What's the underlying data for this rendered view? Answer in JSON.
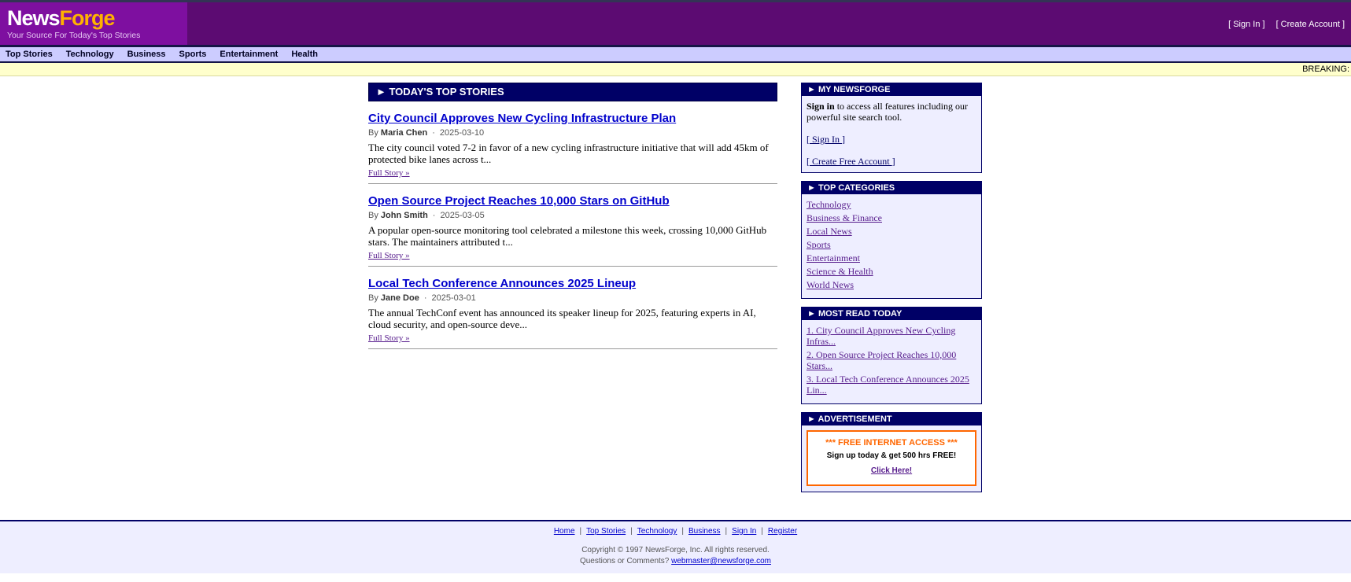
{
  "brand": {
    "name_part1": "News",
    "name_part2": "Forge",
    "tagline": "Your Source For Today's Top Stories"
  },
  "header_links": {
    "sign_in": "[ Sign In ]",
    "create_account": "[ Create Account ]"
  },
  "nav": [
    "Top Stories",
    "Technology",
    "Business",
    "Sports",
    "Entertainment",
    "Health"
  ],
  "breaking_label": "BREAKING:",
  "main": {
    "section_title": "► TODAY'S TOP STORIES",
    "stories": [
      {
        "title": "City Council Approves New Cycling Infrastructure Plan",
        "by": "By",
        "author": "Maria Chen",
        "date": "2025-03-10",
        "summary": "The city council voted 7-2 in favor of a new cycling infrastructure initiative that will add 45km of protected bike lanes across t...",
        "link": "Full Story »"
      },
      {
        "title": "Open Source Project Reaches 10,000 Stars on GitHub",
        "by": "By",
        "author": "John Smith",
        "date": "2025-03-05",
        "summary": "A popular open-source monitoring tool celebrated a milestone this week, crossing 10,000 GitHub stars. The maintainers attributed t...",
        "link": "Full Story »"
      },
      {
        "title": "Local Tech Conference Announces 2025 Lineup",
        "by": "By",
        "author": "Jane Doe",
        "date": "2025-03-01",
        "summary": "The annual TechConf event has announced its speaker lineup for 2025, featuring experts in AI, cloud security, and open-source deve...",
        "link": "Full Story »"
      }
    ]
  },
  "sidebar": {
    "my_newsforge": {
      "title": "► MY NEWSFORGE",
      "sign_in_bold": "Sign in",
      "sign_in_text": " to access all features including our powerful site search tool.",
      "bracket_open": "[",
      "bracket_close": "]",
      "sign_in_link": " Sign In ",
      "create_link": " Create Free Account "
    },
    "categories": {
      "title": "► TOP CATEGORIES",
      "items": [
        "Technology",
        "Business & Finance",
        "Local News",
        "Sports",
        "Entertainment",
        "Science & Health",
        "World News"
      ]
    },
    "most_read": {
      "title": "► MOST READ TODAY",
      "items": [
        "1. City Council Approves New Cycling Infras...",
        "2. Open Source Project Reaches 10,000 Stars...",
        "3. Local Tech Conference Announces 2025 Lin..."
      ]
    },
    "ad": {
      "title": "► ADVERTISEMENT",
      "headline": "*** FREE INTERNET ACCESS ***",
      "text": "Sign up today & get 500 hrs FREE!",
      "link": "Click Here!"
    }
  },
  "footer": {
    "links": [
      "Home",
      "Top Stories",
      "Technology",
      "Business",
      "Sign In",
      "Register"
    ],
    "separator": "|",
    "copyright": "Copyright © 1997 NewsForge, Inc. All rights reserved.",
    "contact_text": "Questions or Comments? ",
    "contact_email": "webmaster@newsforge.com"
  },
  "colors": {
    "header_bg": "#5c0b72",
    "logo_bg": "#7e0fa0",
    "logo_accent": "#ffb200",
    "nav_bg": "#ccccff",
    "section_head": "#000066",
    "story_title": "#0000cc",
    "breaking_bg": "#ffffcc",
    "ad_accent": "#ff6600"
  }
}
